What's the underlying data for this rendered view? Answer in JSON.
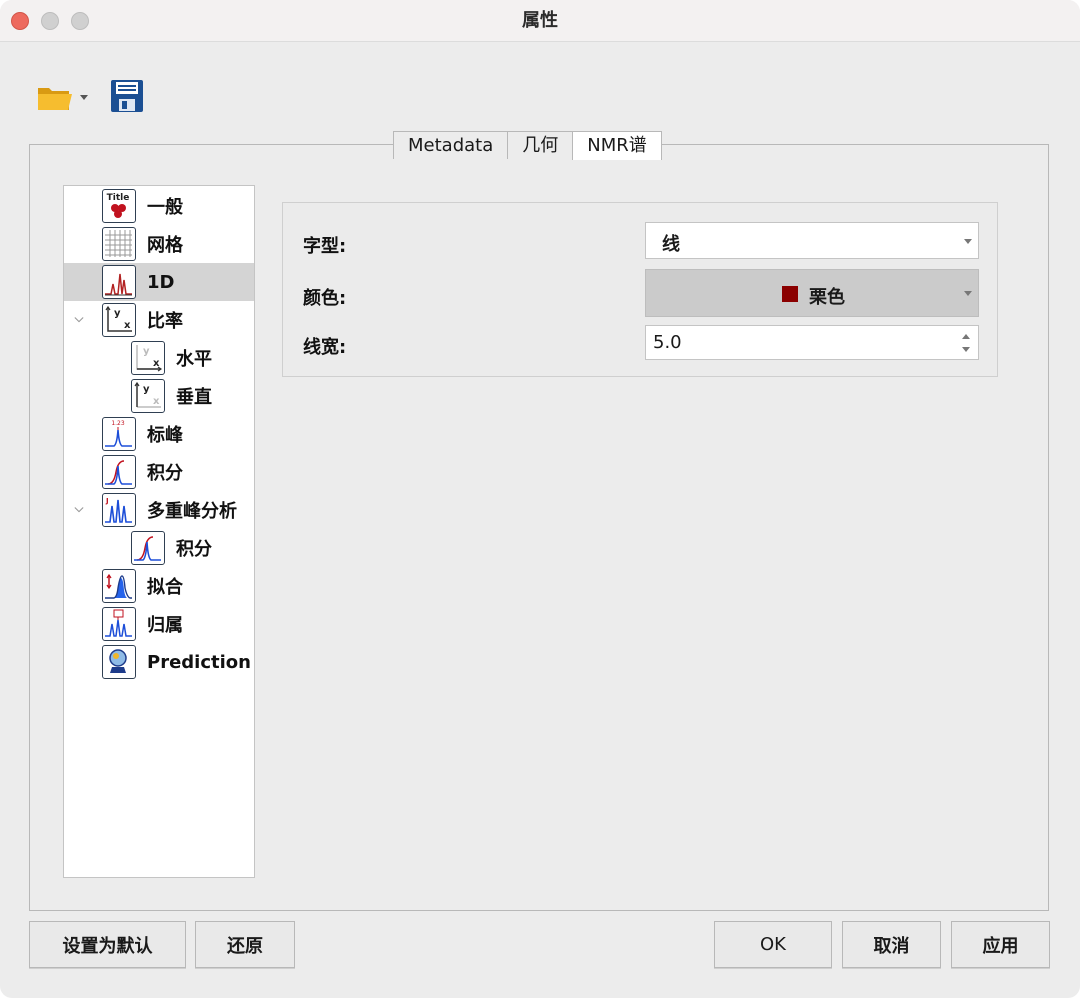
{
  "window": {
    "title": "属性"
  },
  "tabs": [
    "Metadata",
    "几何",
    "NMR谱"
  ],
  "tree": {
    "items": [
      {
        "label": "一般",
        "icon": "title-icon"
      },
      {
        "label": "网格",
        "icon": "grid-icon"
      },
      {
        "label": "1D",
        "icon": "spectrum-1d-icon",
        "selected": true
      },
      {
        "label": "比率",
        "icon": "scale-icon",
        "expanded": true
      },
      {
        "label": "水平",
        "icon": "horizontal-scale-icon"
      },
      {
        "label": "垂直",
        "icon": "vertical-scale-icon"
      },
      {
        "label": "标峰",
        "icon": "peak-label-icon"
      },
      {
        "label": "积分",
        "icon": "integral-icon"
      },
      {
        "label": "多重峰分析",
        "icon": "multiplet-icon",
        "expanded": true
      },
      {
        "label": "积分",
        "icon": "integral-icon"
      },
      {
        "label": "拟合",
        "icon": "fitting-icon"
      },
      {
        "label": "归属",
        "icon": "assignment-icon"
      },
      {
        "label": "Prediction",
        "icon": "prediction-icon"
      }
    ]
  },
  "form": {
    "font_label": "字型:",
    "font_value": "线",
    "color_label": "颜色:",
    "color_value": "栗色",
    "color_swatch": "#8b0000",
    "width_label": "线宽:",
    "width_value": "5.0"
  },
  "buttons": {
    "set_default": "设置为默认",
    "restore": "还原",
    "ok": "OK",
    "cancel": "取消",
    "apply": "应用"
  }
}
